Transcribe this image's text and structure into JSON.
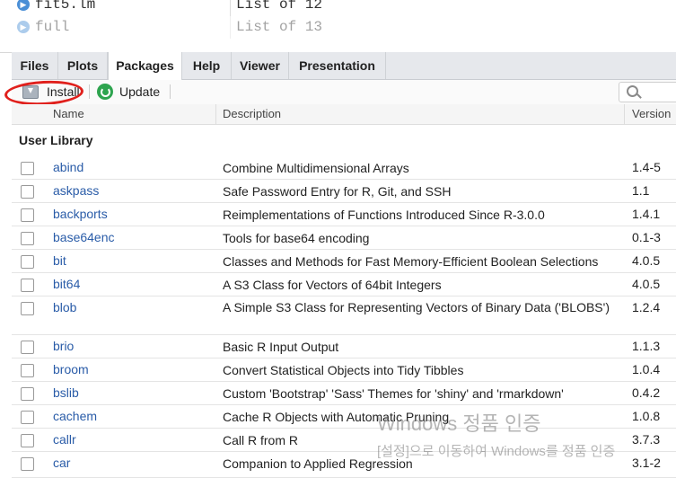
{
  "environment": {
    "rows": [
      {
        "name": "fit5.lm",
        "value": "List of  12"
      },
      {
        "name": "full",
        "value": "List of  13"
      }
    ]
  },
  "tabs": [
    {
      "label": "Files",
      "active": false
    },
    {
      "label": "Plots",
      "active": false
    },
    {
      "label": "Packages",
      "active": true
    },
    {
      "label": "Help",
      "active": false
    },
    {
      "label": "Viewer",
      "active": false
    },
    {
      "label": "Presentation",
      "active": false
    }
  ],
  "toolbar": {
    "install_label": "Install",
    "update_label": "Update",
    "search_placeholder": ""
  },
  "table": {
    "columns": {
      "name": "Name",
      "description": "Description",
      "version": "Version"
    },
    "section": "User Library",
    "rows": [
      {
        "name": "abind",
        "description": "Combine Multidimensional Arrays",
        "version": "1.4-5"
      },
      {
        "name": "askpass",
        "description": "Safe Password Entry for R, Git, and SSH",
        "version": "1.1"
      },
      {
        "name": "backports",
        "description": "Reimplementations of Functions Introduced Since R-3.0.0",
        "version": "1.4.1"
      },
      {
        "name": "base64enc",
        "description": "Tools for base64 encoding",
        "version": "0.1-3"
      },
      {
        "name": "bit",
        "description": "Classes and Methods for Fast Memory-Efficient Boolean Selections",
        "version": "4.0.5"
      },
      {
        "name": "bit64",
        "description": "A S3 Class for Vectors of 64bit Integers",
        "version": "4.0.5"
      },
      {
        "name": "blob",
        "description": "A Simple S3 Class for Representing Vectors of Binary Data ('BLOBS')",
        "version": "1.2.4"
      },
      {
        "name": "brio",
        "description": "Basic R Input Output",
        "version": "1.1.3"
      },
      {
        "name": "broom",
        "description": "Convert Statistical Objects into Tidy Tibbles",
        "version": "1.0.4"
      },
      {
        "name": "bslib",
        "description": "Custom 'Bootstrap' 'Sass' Themes for 'shiny' and 'rmarkdown'",
        "version": "0.4.2"
      },
      {
        "name": "cachem",
        "description": "Cache R Objects with Automatic Pruning",
        "version": "1.0.8"
      },
      {
        "name": "callr",
        "description": "Call R from R",
        "version": "3.7.3"
      },
      {
        "name": "car",
        "description": "Companion to Applied Regression",
        "version": "3.1-2"
      }
    ]
  },
  "watermark": {
    "line1": "Windows 정품 인증",
    "line2": "[설정]으로 이동하여 Windows를 정품 인증"
  }
}
